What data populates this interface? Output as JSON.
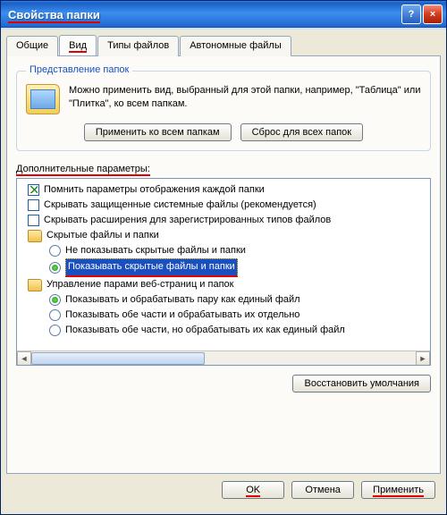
{
  "titlebar": {
    "title": "Свойства папки"
  },
  "tabs": {
    "general": "Общие",
    "view": "Вид",
    "filetypes": "Типы файлов",
    "offline": "Автономные файлы"
  },
  "group": {
    "legend": "Представление папок",
    "text": "Можно применить вид, выбранный для этой папки, например, \"Таблица\" или \"Плитка\", ко всем папкам.",
    "apply_all": "Применить ко всем папкам",
    "reset_all": "Сброс для всех папок"
  },
  "advanced": {
    "label": "Дополнительные параметры:",
    "items": [
      {
        "type": "check",
        "checked": true,
        "indent": 1,
        "label": "Помнить параметры отображения каждой папки"
      },
      {
        "type": "check",
        "checked": false,
        "indent": 1,
        "label": "Скрывать защищенные системные файлы (рекомендуется)"
      },
      {
        "type": "check",
        "checked": false,
        "indent": 1,
        "label": "Скрывать расширения для зарегистрированных типов файлов"
      },
      {
        "type": "folder",
        "indent": 1,
        "label": "Скрытые файлы и папки"
      },
      {
        "type": "radio",
        "checked": false,
        "indent": 2,
        "label": "Не показывать скрытые файлы и папки"
      },
      {
        "type": "radio",
        "checked": true,
        "indent": 2,
        "label": "Показывать скрытые файлы и папки",
        "selected": true,
        "highlight": true
      },
      {
        "type": "folder",
        "indent": 1,
        "label": "Управление парами веб-страниц и папок"
      },
      {
        "type": "radio",
        "checked": true,
        "indent": 2,
        "label": "Показывать и обрабатывать пару как единый файл"
      },
      {
        "type": "radio",
        "checked": false,
        "indent": 2,
        "label": "Показывать обе части и обрабатывать их отдельно"
      },
      {
        "type": "radio",
        "checked": false,
        "indent": 2,
        "label": "Показывать обе части, но обрабатывать их как единый файл"
      }
    ],
    "restore": "Восстановить умолчания"
  },
  "buttons": {
    "ok": "OK",
    "cancel": "Отмена",
    "apply": "Применить"
  }
}
